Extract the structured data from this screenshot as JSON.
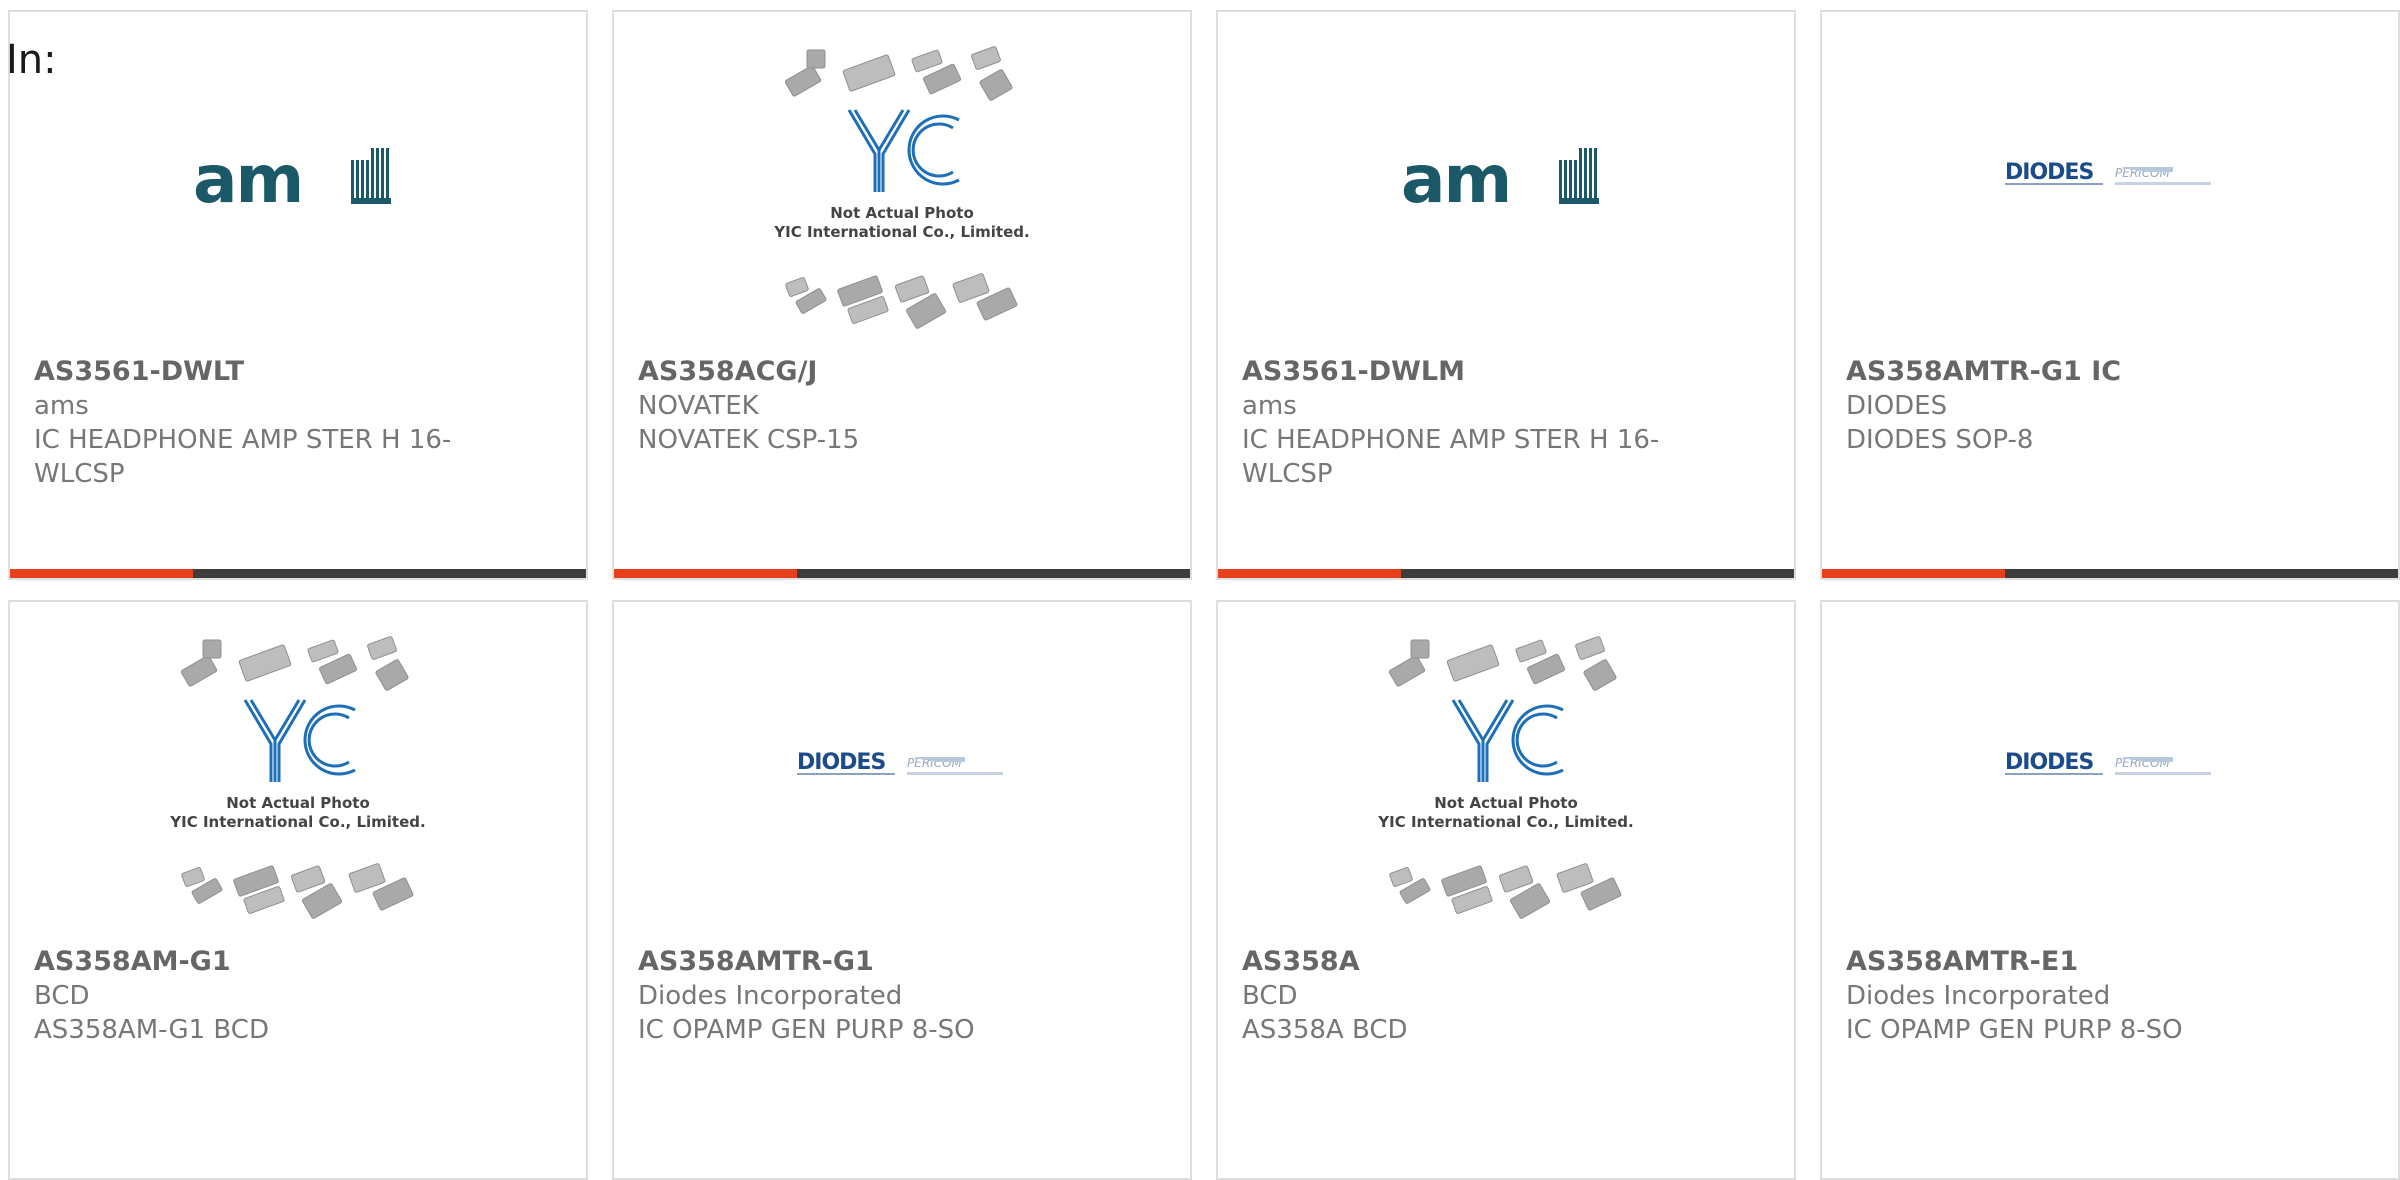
{
  "header": {
    "in_label": "In:"
  },
  "placeholder": {
    "line1": "Not Actual Photo",
    "line2": "YIC International Co., Limited."
  },
  "colors": {
    "accent": "#e8401c",
    "bar": "#3d3d3d",
    "ams": "#1b5868",
    "diodes": "#1b4b8a",
    "yic": "#1e6fb8"
  },
  "products": [
    {
      "part": "AS3561-DWLT",
      "maker": "ams",
      "desc": "IC HEADPHONE AMP STER H 16-WLCSP",
      "image": "ams-logo"
    },
    {
      "part": "AS358ACG/J",
      "maker": "NOVATEK",
      "desc": "NOVATEK CSP-15",
      "image": "yic-placeholder"
    },
    {
      "part": "AS3561-DWLM",
      "maker": "ams",
      "desc": "IC HEADPHONE AMP STER H 16-WLCSP",
      "image": "ams-logo"
    },
    {
      "part": "AS358AMTR-G1 IC",
      "maker": "DIODES",
      "desc": "DIODES SOP-8",
      "image": "diodes-logo"
    },
    {
      "part": "AS358AM-G1",
      "maker": "BCD",
      "desc": "AS358AM-G1 BCD",
      "image": "yic-placeholder"
    },
    {
      "part": "AS358AMTR-G1",
      "maker": "Diodes Incorporated",
      "desc": "IC OPAMP GEN PURP 8-SO",
      "image": "diodes-logo"
    },
    {
      "part": "AS358A",
      "maker": "BCD",
      "desc": "AS358A BCD",
      "image": "yic-placeholder"
    },
    {
      "part": "AS358AMTR-E1",
      "maker": "Diodes Incorporated",
      "desc": "IC OPAMP GEN PURP 8-SO",
      "image": "diodes-logo"
    }
  ]
}
